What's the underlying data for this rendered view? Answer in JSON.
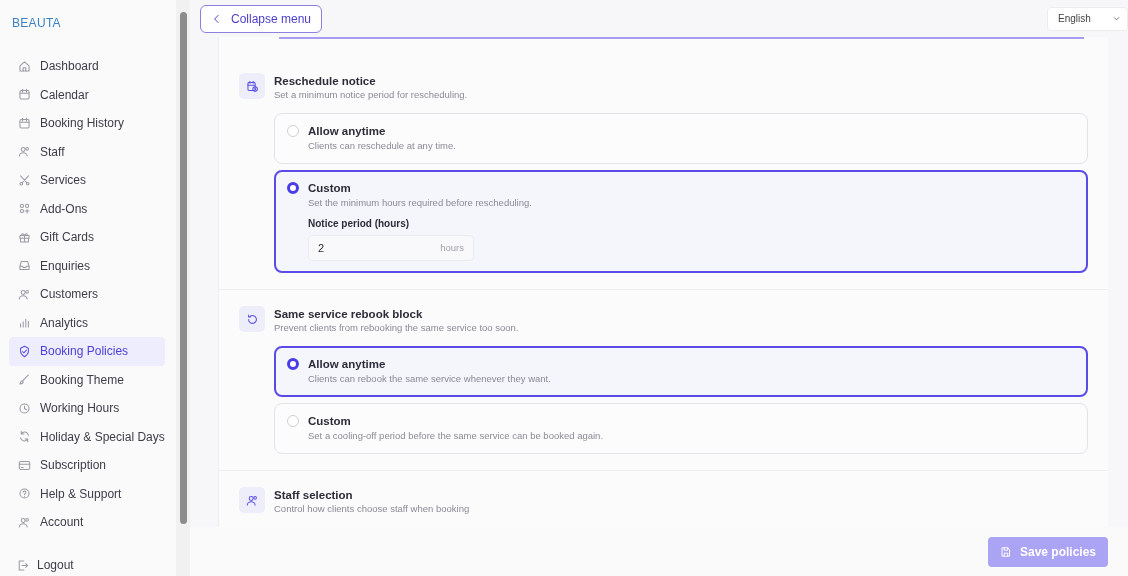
{
  "logo": {
    "text": "BEAUTA"
  },
  "sidebar": {
    "items": [
      {
        "label": "Dashboard",
        "selected": false
      },
      {
        "label": "Calendar",
        "selected": false
      },
      {
        "label": "Booking History",
        "selected": false
      },
      {
        "label": "Staff",
        "selected": false
      },
      {
        "label": "Services",
        "selected": false
      },
      {
        "label": "Add-Ons",
        "selected": false
      },
      {
        "label": "Gift Cards",
        "selected": false
      },
      {
        "label": "Enquiries",
        "selected": false
      },
      {
        "label": "Customers",
        "selected": false
      },
      {
        "label": "Analytics",
        "selected": false
      },
      {
        "label": "Booking Policies",
        "selected": true
      },
      {
        "label": "Booking Theme",
        "selected": false
      },
      {
        "label": "Working Hours",
        "selected": false
      },
      {
        "label": "Holiday & Special Days",
        "selected": false
      },
      {
        "label": "Subscription",
        "selected": false
      },
      {
        "label": "Help & Support",
        "selected": false
      },
      {
        "label": "Account",
        "selected": false
      }
    ],
    "logout": "Logout"
  },
  "topbar": {
    "collapse_button": "Collapse menu",
    "language": "English"
  },
  "sections": [
    {
      "title": "Reschedule notice",
      "description": "Set a minimum notice period for rescheduling.",
      "options": [
        {
          "title": "Allow anytime",
          "description": "Clients can reschedule at any time.",
          "selected": false
        },
        {
          "title": "Custom",
          "description": "Set the minimum hours required before rescheduling.",
          "selected": true,
          "field": {
            "label": "Notice period (hours)",
            "value": "2",
            "unit": "hours"
          }
        }
      ]
    },
    {
      "title": "Same service rebook block",
      "description": "Prevent clients from rebooking the same service too soon.",
      "options": [
        {
          "title": "Allow anytime",
          "description": "Clients can rebook the same service whenever they want.",
          "selected": true
        },
        {
          "title": "Custom",
          "description": "Set a cooling-off period before the same service can be booked again.",
          "selected": false
        }
      ]
    },
    {
      "title": "Staff selection",
      "description": "Control how clients choose staff when booking"
    }
  ],
  "save_button": "Save policies"
}
